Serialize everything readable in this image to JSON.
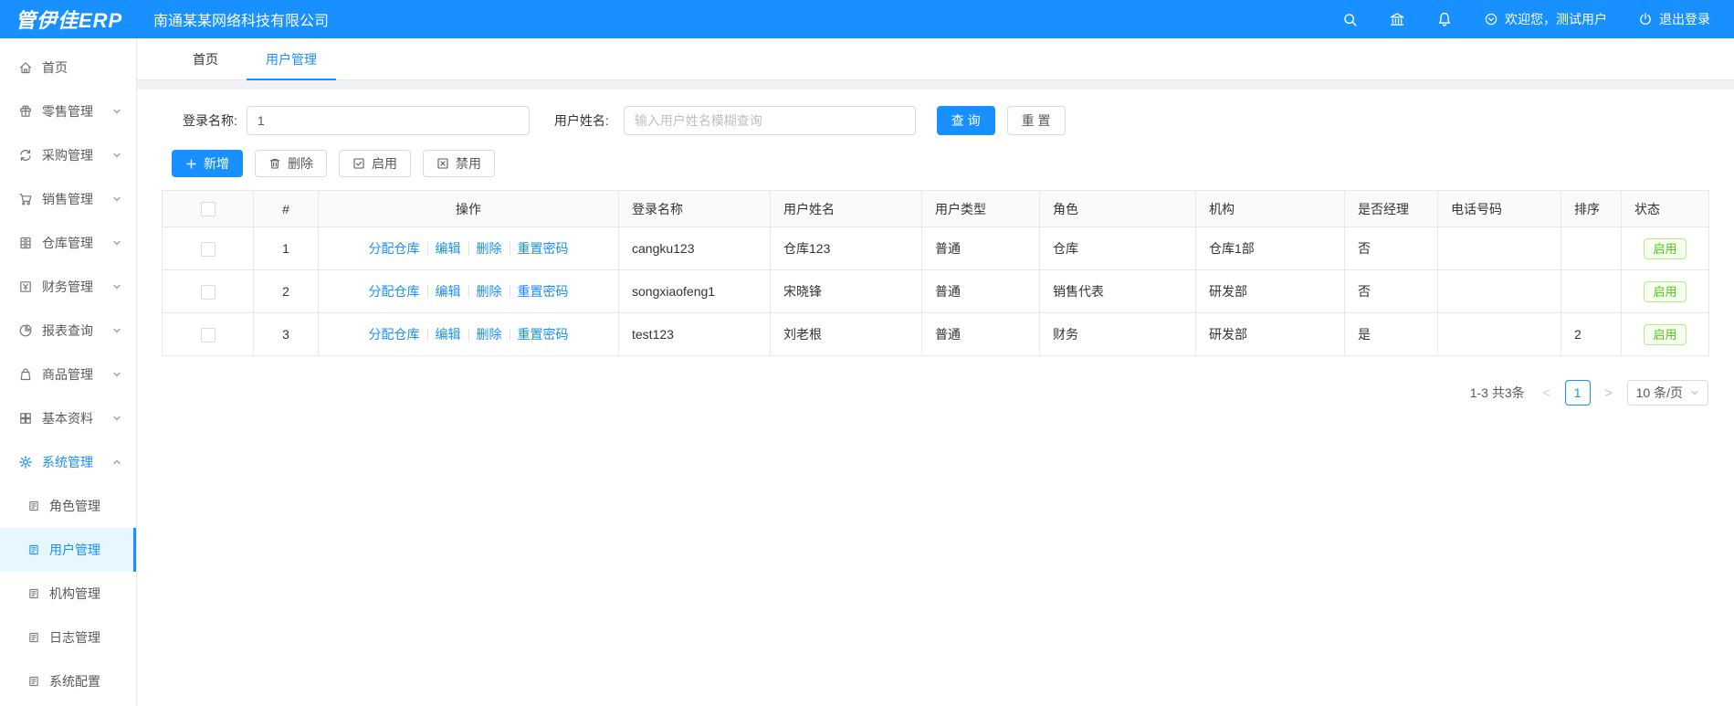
{
  "header": {
    "logo": "管伊佳ERP",
    "company": "南通某某网络科技有限公司",
    "welcome": "欢迎您，测试用户",
    "logout": "退出登录"
  },
  "tabs": [
    {
      "label": "首页"
    },
    {
      "label": "用户管理"
    }
  ],
  "sidebar": {
    "items": [
      {
        "label": "首页",
        "icon": "home-icon"
      },
      {
        "label": "零售管理",
        "icon": "gift-icon"
      },
      {
        "label": "采购管理",
        "icon": "sync-icon"
      },
      {
        "label": "销售管理",
        "icon": "cart-icon"
      },
      {
        "label": "仓库管理",
        "icon": "warehouse-icon"
      },
      {
        "label": "财务管理",
        "icon": "finance-icon"
      },
      {
        "label": "报表查询",
        "icon": "pie-chart-icon"
      },
      {
        "label": "商品管理",
        "icon": "bag-icon"
      },
      {
        "label": "基本资料",
        "icon": "grid-icon"
      },
      {
        "label": "系统管理",
        "icon": "gear-icon",
        "expanded": true,
        "active": true
      }
    ],
    "sub_items": [
      {
        "label": "角色管理"
      },
      {
        "label": "用户管理",
        "active": true
      },
      {
        "label": "机构管理"
      },
      {
        "label": "日志管理"
      },
      {
        "label": "系统配置"
      }
    ]
  },
  "search": {
    "login_label": "登录名称:",
    "login_value": "1",
    "name_label": "用户姓名:",
    "name_placeholder": "输入用户姓名模糊查询",
    "query_button": "查 询",
    "reset_button": "重 置"
  },
  "toolbar": {
    "add": "新增",
    "delete": "删除",
    "enable": "启用",
    "disable": "禁用"
  },
  "table": {
    "headers": [
      "#",
      "操作",
      "登录名称",
      "用户姓名",
      "用户类型",
      "角色",
      "机构",
      "是否经理",
      "电话号码",
      "排序",
      "状态"
    ],
    "action_links": [
      "分配仓库",
      "编辑",
      "删除",
      "重置密码"
    ],
    "rows": [
      {
        "index": "1",
        "login": "cangku123",
        "name": "仓库123",
        "type": "普通",
        "role": "仓库",
        "org": "仓库1部",
        "manager": "否",
        "phone": "",
        "sort": "",
        "status": "启用"
      },
      {
        "index": "2",
        "login": "songxiaofeng1",
        "name": "宋晓锋",
        "type": "普通",
        "role": "销售代表",
        "org": "研发部",
        "manager": "否",
        "phone": "",
        "sort": "",
        "status": "启用"
      },
      {
        "index": "3",
        "login": "test123",
        "name": "刘老根",
        "type": "普通",
        "role": "财务",
        "org": "研发部",
        "manager": "是",
        "phone": "",
        "sort": "2",
        "status": "启用"
      }
    ]
  },
  "pagination": {
    "total": "1-3 共3条",
    "prev": "<",
    "page": "1",
    "next": ">",
    "page_size": "10 条/页"
  },
  "colors": {
    "primary": "#1890ff",
    "success_text": "#52c41a",
    "success_border": "#b7eb8f",
    "success_bg": "#f6ffed"
  }
}
